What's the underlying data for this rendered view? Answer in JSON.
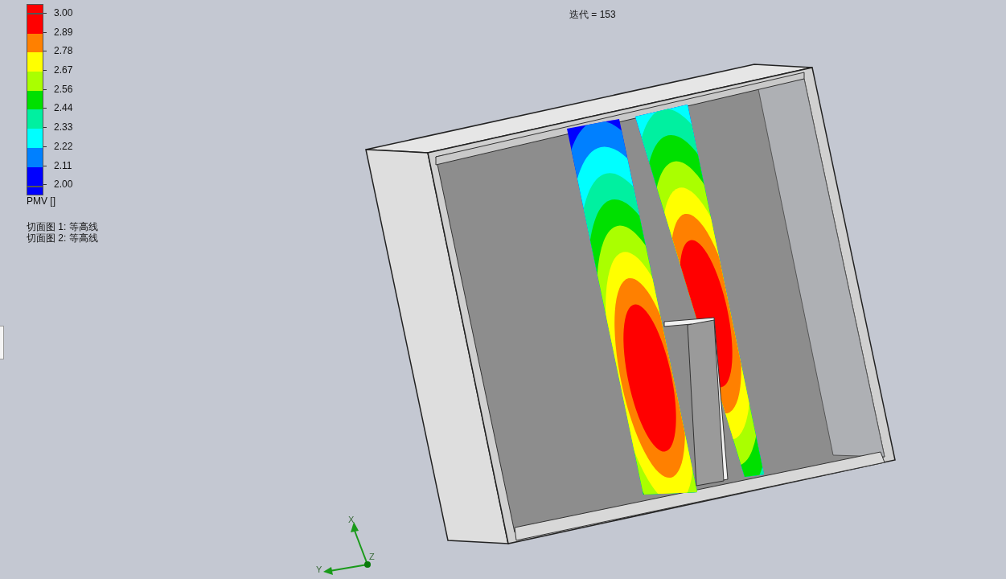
{
  "viewport": {
    "iteration_label": "迭代 = 153"
  },
  "legend": {
    "overflow_top": {
      "color": "#ff0000"
    },
    "overflow_bottom": {
      "color": "#0000ff"
    },
    "bands": [
      {
        "color": "#ff0000"
      },
      {
        "color": "#ff8000"
      },
      {
        "color": "#ffff00"
      },
      {
        "color": "#aaff00"
      },
      {
        "color": "#00e000"
      },
      {
        "color": "#00f0a0"
      },
      {
        "color": "#00ffff"
      },
      {
        "color": "#0080ff"
      },
      {
        "color": "#0000ff"
      }
    ],
    "ticks": [
      "3.00",
      "2.89",
      "2.78",
      "2.67",
      "2.56",
      "2.44",
      "2.33",
      "2.22",
      "2.11",
      "2.00"
    ],
    "title": "PMV []",
    "notes": [
      "切面图 1: 等高线",
      "切面图 2: 等高线"
    ]
  },
  "axes": {
    "x": "X",
    "y": "Y",
    "z": "Z"
  }
}
